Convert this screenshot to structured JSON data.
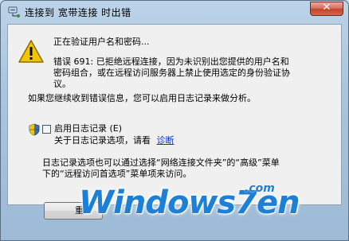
{
  "window": {
    "title": "连接到 宽带连接 时出错",
    "close_label": "✕"
  },
  "dialog": {
    "status_line": "正在验证用户名和密码...",
    "error_line1": "错误 691: 已拒绝远程连接，因为未识别出您提供的用户名和",
    "error_line2": "密码组合，或在远程访问服务器上禁止使用选定的身份验证协",
    "error_line3": "议。",
    "log_hint": "如果您继续收到错误信息，您可以启用日志记录来做分析。",
    "enable_logging_label": "启用日志记录 (E)",
    "about_logging_prefix": "关于日志记录选项，请看",
    "diagnose_link": "诊断",
    "info_line1": "日志记录选项也可以通过选择“网络连接文件夹”的“高级”菜单",
    "info_line2": "下的“远程访问首选项”菜单项来访问。",
    "redial_button_fragment": "重"
  },
  "watermark": {
    "main": "Windows7en",
    "suffix": ".com"
  },
  "colors": {
    "link": "#0033cc",
    "watermark": "#1e7fd6",
    "warning": "#f5c400"
  },
  "icons": [
    "network-connection-icon",
    "warning-icon",
    "shield-icon",
    "close-icon"
  ]
}
